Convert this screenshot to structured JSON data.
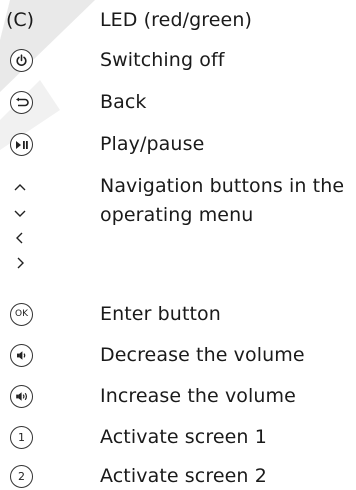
{
  "legend": {
    "items": [
      {
        "symbol_text": "(C)",
        "label": "LED (red/green)"
      },
      {
        "icon": "power-icon",
        "label": "Switching off"
      },
      {
        "icon": "back-icon",
        "label": "Back"
      },
      {
        "icon": "play-pause-icon",
        "label": "Play/pause"
      },
      {
        "icons": [
          "arrow-up-icon",
          "arrow-down-icon",
          "arrow-left-icon",
          "arrow-right-icon"
        ],
        "label_line1": "Navigation buttons in the",
        "label_line2": "operating menu"
      },
      {
        "icon": "ok-icon",
        "icon_text": "OK",
        "label": "Enter button"
      },
      {
        "icon": "volume-down-icon",
        "label": "Decrease the volume"
      },
      {
        "icon": "volume-up-icon",
        "label": "Increase the volume"
      },
      {
        "icon": "screen-1-icon",
        "icon_text": "1",
        "label": "Activate screen 1"
      },
      {
        "icon": "screen-2-icon",
        "icon_text": "2",
        "label": "Activate screen 2"
      }
    ]
  },
  "colors": {
    "text": "#1a1a1a",
    "watermark": "#e6e6e6"
  }
}
